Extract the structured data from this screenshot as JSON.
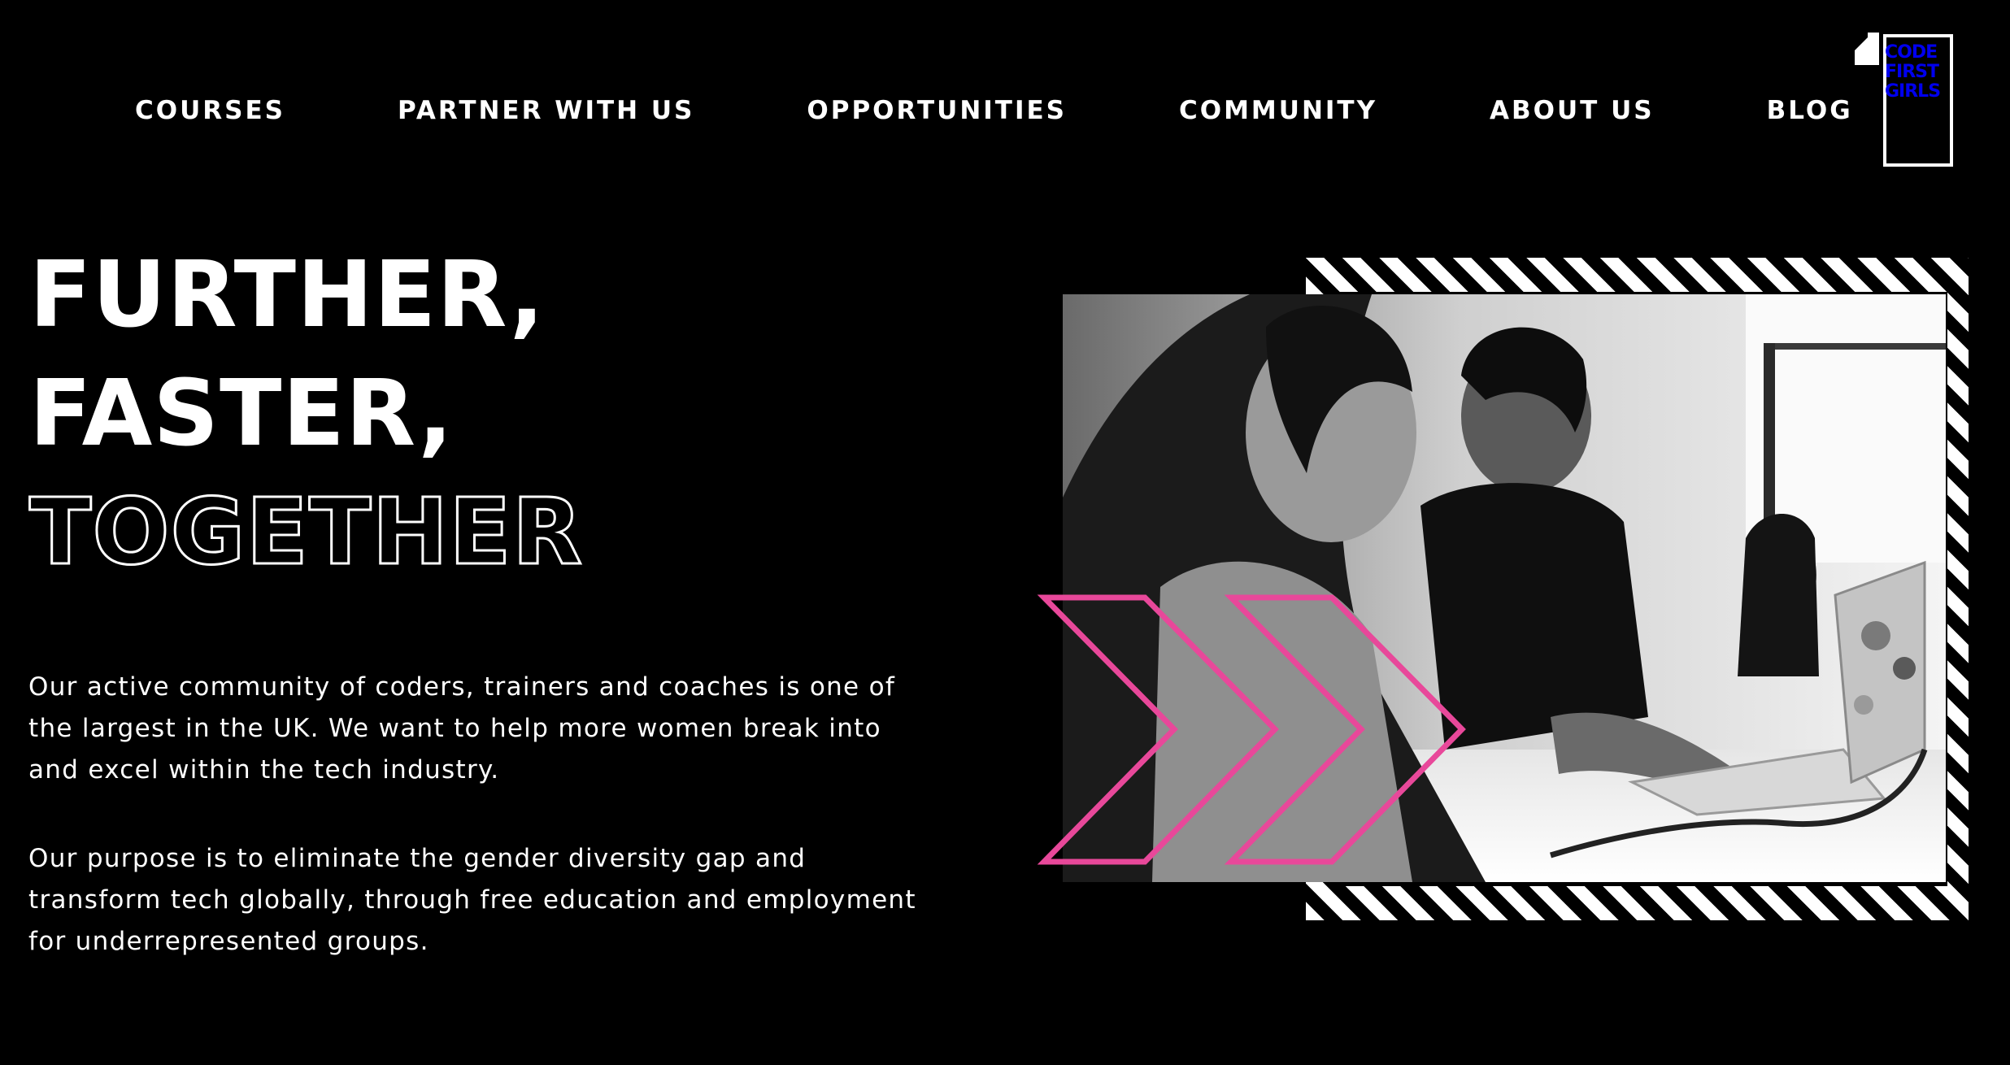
{
  "nav": {
    "items": [
      "COURSES",
      "PARTNER WITH US",
      "OPPORTUNITIES",
      "COMMUNITY",
      "ABOUT US",
      "BLOG"
    ]
  },
  "logo": {
    "lines": [
      "CODE",
      "FIRST",
      "GIRLS"
    ]
  },
  "hero": {
    "line1": "FURTHER,",
    "line2": "FASTER,",
    "line3": "TOGETHER"
  },
  "body": {
    "paragraph1": "Our active community of coders, trainers and coaches is one of the largest in the UK. We want to help more women break into and excel within the tech industry.",
    "paragraph2": "Our purpose is to eliminate the gender diversity gap and transform tech globally, through free education and employment for underrepresented groups."
  },
  "colors": {
    "background": "#000000",
    "text": "#ffffff",
    "accent": "#e8489a"
  },
  "icons": {
    "logo": "code-first-girls-logo",
    "chevrons": "double-chevron-arrow-icon"
  }
}
